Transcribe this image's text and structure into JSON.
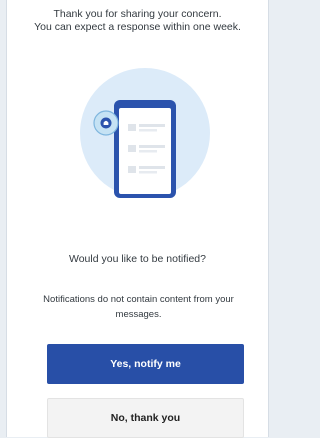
{
  "message": {
    "line1": "Thank you for sharing your concern.",
    "line2": "You can expect a response within one week."
  },
  "illustration": {
    "icon": "phone-with-notification-icon",
    "accent_color": "#2b53ad",
    "circle_color": "#dcebf9"
  },
  "prompt": {
    "question": "Would you like to be notified?",
    "note": "Notifications do not contain content from your messages."
  },
  "buttons": {
    "primary_label": "Yes, notify me",
    "secondary_label": "No, thank you"
  }
}
